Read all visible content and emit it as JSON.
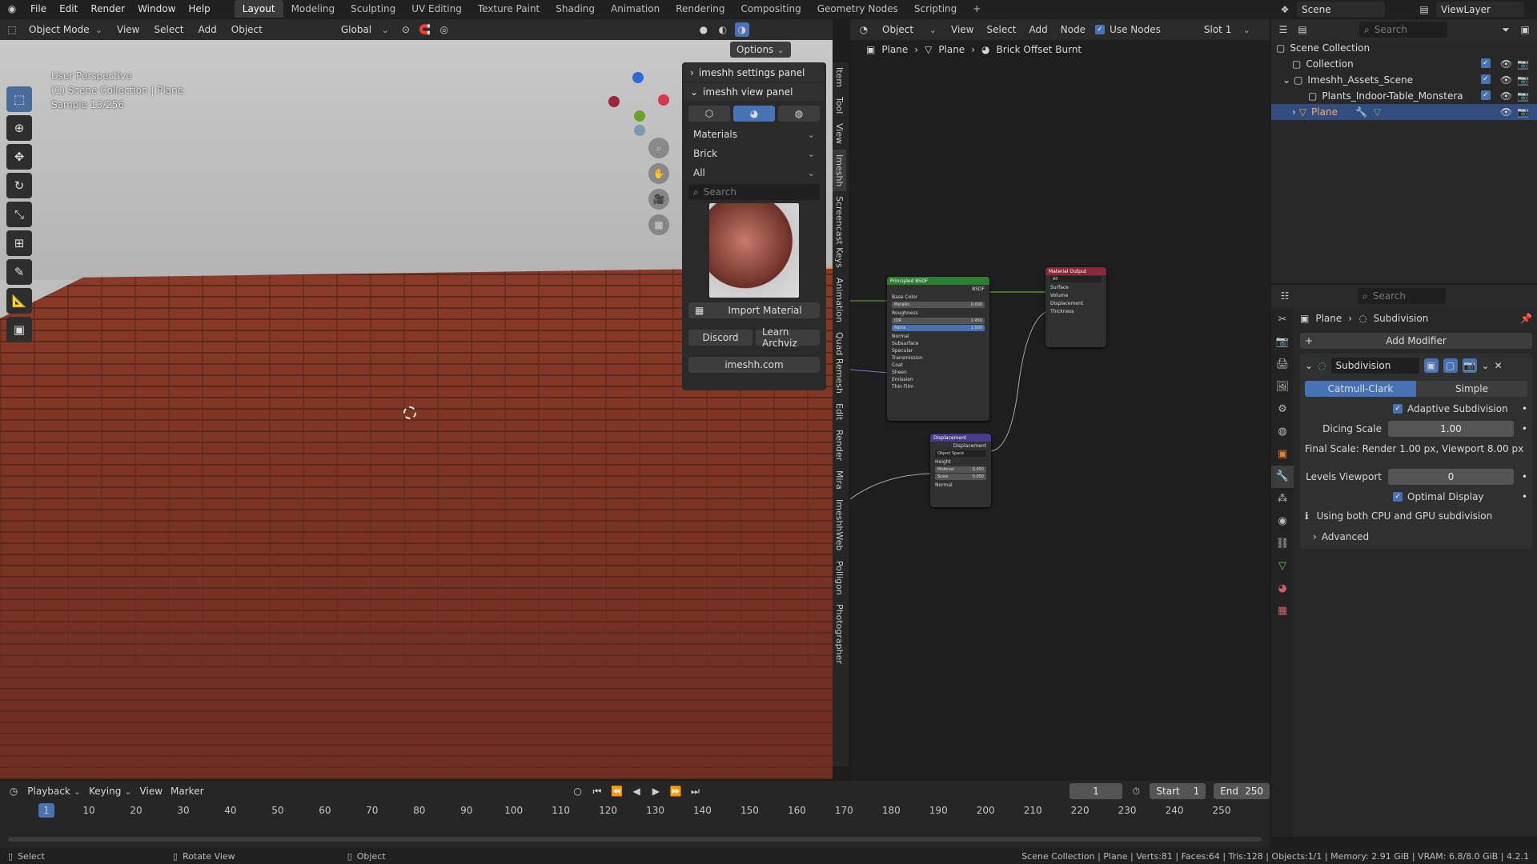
{
  "menu": [
    "File",
    "Edit",
    "Render",
    "Window",
    "Help"
  ],
  "workspaces": [
    "Layout",
    "Modeling",
    "Sculpting",
    "UV Editing",
    "Texture Paint",
    "Shading",
    "Animation",
    "Rendering",
    "Compositing",
    "Geometry Nodes",
    "Scripting"
  ],
  "top_right": {
    "scene": "Scene",
    "view_layer": "ViewLayer"
  },
  "viewport": {
    "mode": "Object Mode",
    "menus": [
      "View",
      "Select",
      "Add",
      "Object"
    ],
    "transform": "Global",
    "options": "Options",
    "overlay_lines": [
      "User Perspective",
      "(1) Scene Collection | Plane",
      "Sample 13/256"
    ]
  },
  "imeshh": {
    "settings_title": "imeshh settings panel",
    "view_title": "imeshh view panel",
    "category": "Materials",
    "subcategory": "Brick",
    "filter": "All",
    "search_placeholder": "Search",
    "import_label": "Import Material",
    "discord": "Discord",
    "learn": "Learn Archviz",
    "site": "imeshh.com"
  },
  "sidetabs": [
    "Item",
    "Tool",
    "View",
    "Imeshh",
    "Screencast Keys",
    "Animation",
    "Quad Remesh",
    "Edit",
    "Render",
    "Mira",
    "ImeshhWeb",
    "Polligon",
    "Photographer"
  ],
  "node_editor": {
    "object": "Object",
    "menus": [
      "View",
      "Select",
      "Add",
      "Node"
    ],
    "use_nodes": "Use Nodes",
    "slot": "Slot 1",
    "breadcrumb": [
      "Plane",
      "Plane",
      "Brick Offset Burnt"
    ],
    "bsdf": {
      "title": "Principled BSDF",
      "out": "BSDF",
      "rows": [
        "Base Color"
      ],
      "fields": [
        {
          "label": "Metallic",
          "value": "0.000"
        },
        {
          "label": "Roughness",
          "value": ""
        },
        {
          "label": "IOR",
          "value": "1.450"
        },
        {
          "label": "Alpha",
          "value": "1.000"
        }
      ],
      "rows2": [
        "Normal",
        "Subsurface",
        "Specular",
        "Transmission",
        "Coat",
        "Sheen",
        "Emission",
        "Thin Film"
      ]
    },
    "output": {
      "title": "Material Output",
      "target": "All",
      "rows": [
        "Surface",
        "Volume",
        "Displacement",
        "Thickness"
      ]
    },
    "displacement": {
      "title": "Displacement",
      "out": "Displacement",
      "space": "Object Space",
      "rows": [
        "Height"
      ],
      "fields": [
        {
          "label": "Midlevel",
          "value": "0.450"
        },
        {
          "label": "Scale",
          "value": "0.050"
        }
      ],
      "rows2": [
        "Normal"
      ]
    }
  },
  "outliner": {
    "search_placeholder": "Search",
    "items": [
      {
        "label": "Scene Collection",
        "indent": 0
      },
      {
        "label": "Collection",
        "indent": 1
      },
      {
        "label": "Imeshh_Assets_Scene",
        "indent": 1
      },
      {
        "label": "Plants_Indoor-Table_Monstera-Vas",
        "indent": 2
      },
      {
        "label": "Plane",
        "indent": 1
      }
    ]
  },
  "properties": {
    "search_placeholder": "Search",
    "breadcrumb": [
      "Plane",
      "Subdivision"
    ],
    "add_modifier": "Add Modifier",
    "modifier_name": "Subdivision",
    "type_a": "Catmull-Clark",
    "type_b": "Simple",
    "adaptive": "Adaptive Subdivision",
    "dicing_label": "Dicing Scale",
    "dicing_value": "1.00",
    "final_scale": "Final Scale: Render 1.00 px, Viewport 8.00 px",
    "levels_label": "Levels Viewport",
    "levels_value": "0",
    "optimal": "Optimal Display",
    "info": "Using both CPU and GPU subdivision",
    "advanced": "Advanced"
  },
  "timeline": {
    "menus": [
      "Playback",
      "Keying",
      "View",
      "Marker"
    ],
    "current": "1",
    "start_label": "Start",
    "start": "1",
    "end_label": "End",
    "end": "250",
    "ticks": [
      "1",
      "10",
      "20",
      "30",
      "40",
      "50",
      "60",
      "70",
      "80",
      "90",
      "100",
      "110",
      "120",
      "130",
      "140",
      "150",
      "160",
      "170",
      "180",
      "190",
      "200",
      "210",
      "220",
      "230",
      "240",
      "250"
    ]
  },
  "status": {
    "left": [
      "Select",
      "Rotate View",
      "Object"
    ],
    "right": "Scene Collection | Plane | Verts:81 | Faces:64 | Tris:128 | Objects:1/1 | Memory: 2.91 GiB | VRAM: 6.8/8.0 GiB | 4.2.1"
  }
}
